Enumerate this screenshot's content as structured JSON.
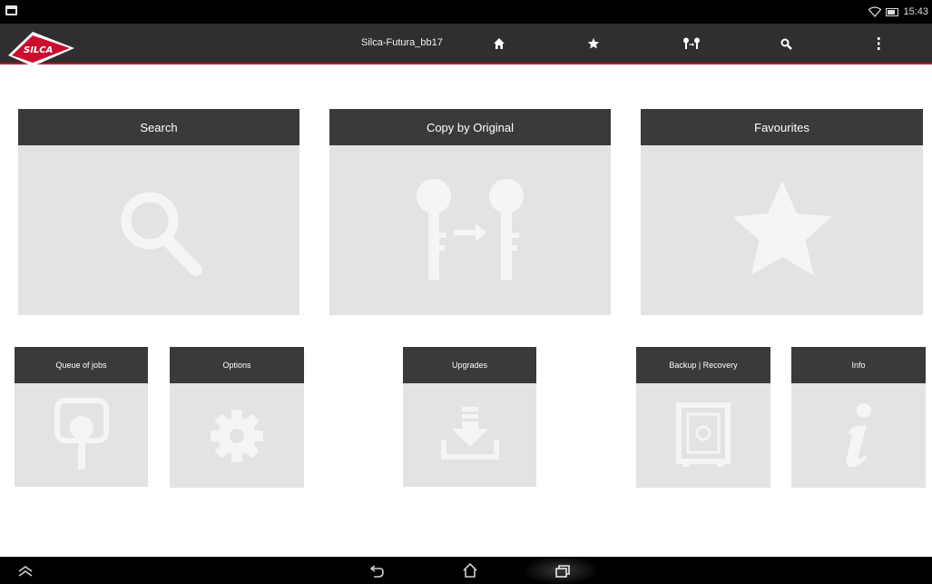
{
  "statusbar": {
    "time": "15:43"
  },
  "appbar": {
    "logo_text": "SILCA",
    "title": "Silca-Futura_bb17",
    "actions": [
      "home-icon",
      "star-icon",
      "keys-icon",
      "search-icon",
      "more-vert-icon"
    ]
  },
  "tiles": {
    "search": {
      "label": "Search",
      "icon": "search-icon"
    },
    "copy": {
      "label": "Copy by Original",
      "icon": "key-copy-icon"
    },
    "favourites": {
      "label": "Favourites",
      "icon": "star-icon"
    },
    "queue": {
      "label": "Queue of jobs",
      "icon": "key-queue-icon"
    },
    "options": {
      "label": "Options",
      "icon": "gear-icon"
    },
    "upgrades": {
      "label": "Upgrades",
      "icon": "download-icon"
    },
    "backup": {
      "label": "Backup | Recovery",
      "icon": "safe-icon"
    },
    "info": {
      "label": "Info",
      "icon": "info-icon"
    }
  },
  "navbar": {
    "buttons": [
      "collapse-icon",
      "back-icon",
      "home-icon",
      "recents-icon"
    ]
  },
  "colors": {
    "header": "#2f2f2f",
    "accent": "#c8102e",
    "tile_bg": "#e3e3e3",
    "tile_header": "#3a3a3a",
    "icon": "#f5f5f5"
  }
}
